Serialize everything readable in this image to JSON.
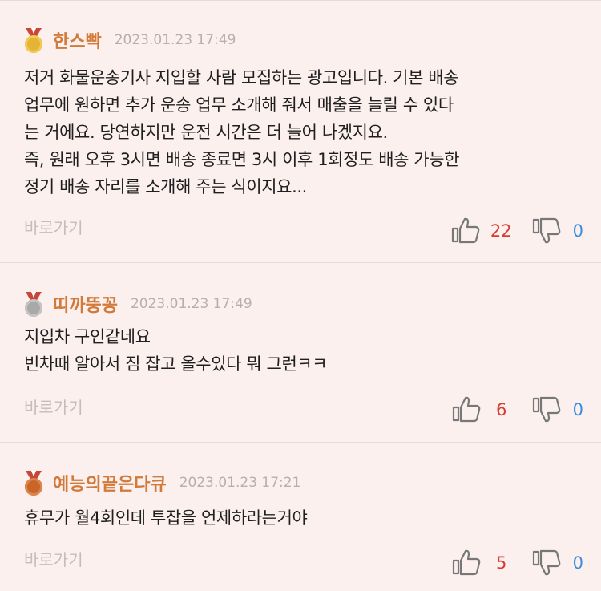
{
  "comments": [
    {
      "medal": "gold-medal",
      "nickname": "한스빡",
      "date": "2023.01.23 17:49",
      "lines": [
        "저거 화물운송기사 지입할 사람 모집하는 광고입니다. 기본 배송",
        "업무에 원하면 추가 운송 업무 소개해 줘서 매출을 늘릴 수 있다",
        "는 거에요. 당연하지만 운전 시간은 더 늘어 나겠지요.",
        "즉, 원래 오후 3시면 배송 종료면 3시 이후 1회정도 배송 가능한",
        "정기 배송 자리를 소개해 주는 식이지요..."
      ],
      "goto_label": "바로가기",
      "likes": "22",
      "dislikes": "0"
    },
    {
      "medal": "silver-medal",
      "nickname": "띠까뚱꽁",
      "date": "2023.01.23 17:49",
      "lines": [
        "지입차 구인같네요",
        "빈차때 알아서 짐 잡고 올수있다 뭐 그런ㅋㅋ"
      ],
      "goto_label": "바로가기",
      "likes": "6",
      "dislikes": "0"
    },
    {
      "medal": "bronze-medal",
      "nickname": "예능의끝은다큐",
      "date": "2023.01.23 17:21",
      "lines": [
        "휴무가 월4회인데 투잡을 언제하라는거야"
      ],
      "goto_label": "바로가기",
      "likes": "5",
      "dislikes": "0"
    }
  ],
  "icons": {
    "like": "thumbs-up-icon",
    "dislike": "thumbs-down-icon"
  },
  "colors": {
    "nickname": "#d27a3a",
    "like_count": "#d93a32",
    "dislike_count": "#3c8de0"
  }
}
